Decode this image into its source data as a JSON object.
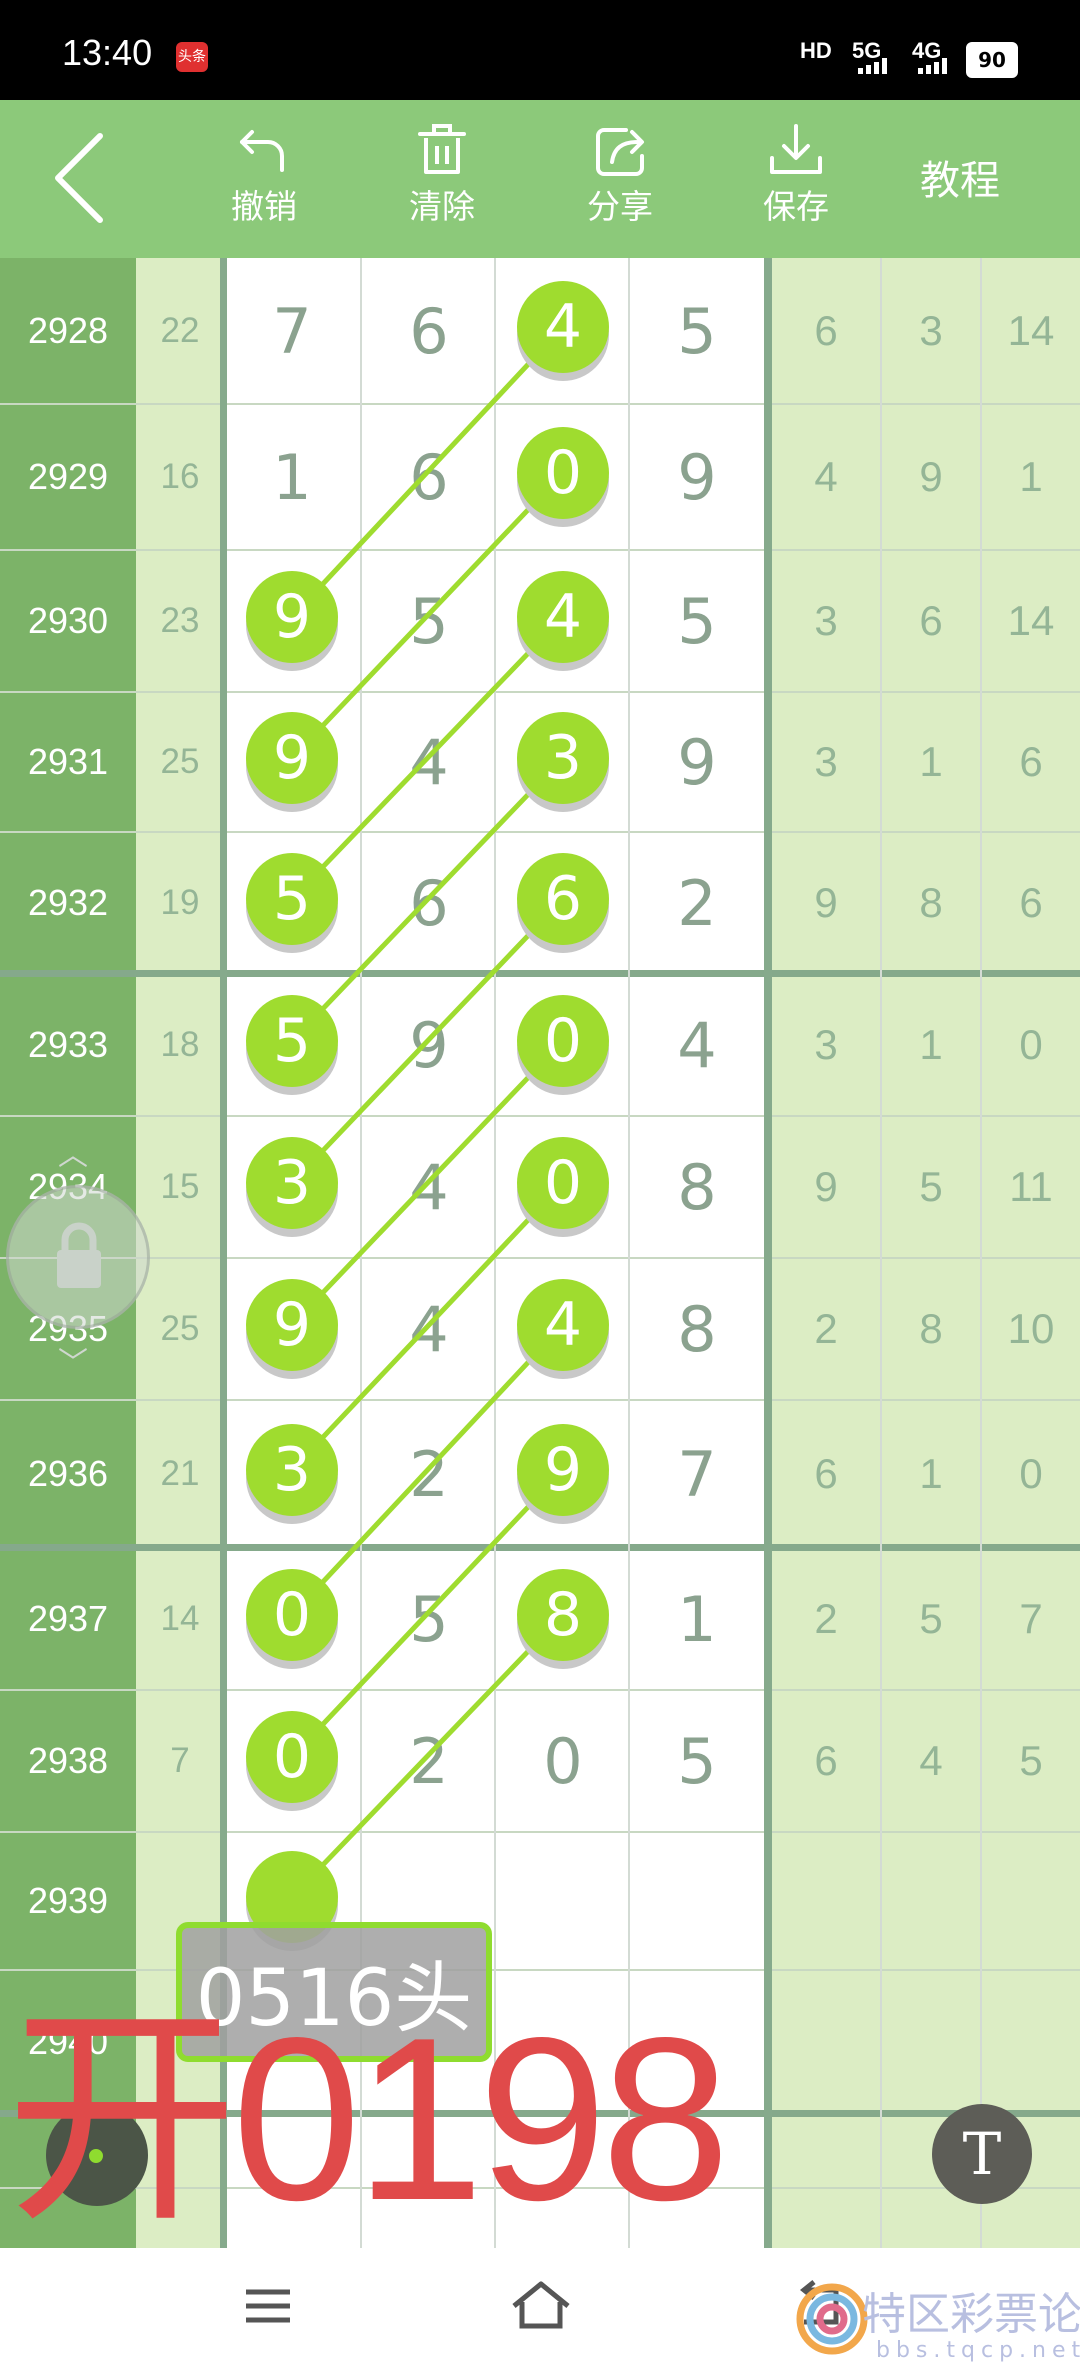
{
  "status_bar": {
    "time": "13:40",
    "app_badge": "头条",
    "hd_label": "HD",
    "net1": "5G",
    "net2": "4G",
    "battery": "90"
  },
  "toolbar": {
    "undo": "撤销",
    "clear": "清除",
    "share": "分享",
    "save": "保存",
    "tutorial": "教程"
  },
  "table": {
    "rows": [
      {
        "issue": "2928",
        "sum": "22",
        "digits": [
          "7",
          "6",
          "4",
          "5"
        ],
        "right": [
          "6",
          "3",
          "14"
        ]
      },
      {
        "issue": "2929",
        "sum": "16",
        "digits": [
          "1",
          "6",
          "0",
          "9"
        ],
        "right": [
          "4",
          "9",
          "1"
        ]
      },
      {
        "issue": "2930",
        "sum": "23",
        "digits": [
          "9",
          "5",
          "4",
          "5"
        ],
        "right": [
          "3",
          "6",
          "14"
        ]
      },
      {
        "issue": "2931",
        "sum": "25",
        "digits": [
          "9",
          "4",
          "3",
          "9"
        ],
        "right": [
          "3",
          "1",
          "6"
        ]
      },
      {
        "issue": "2932",
        "sum": "19",
        "digits": [
          "5",
          "6",
          "6",
          "2"
        ],
        "right": [
          "9",
          "8",
          "6"
        ]
      },
      {
        "issue": "2933",
        "sum": "18",
        "digits": [
          "5",
          "9",
          "0",
          "4"
        ],
        "right": [
          "3",
          "1",
          "0"
        ]
      },
      {
        "issue": "2934",
        "sum": "15",
        "digits": [
          "3",
          "4",
          "0",
          "8"
        ],
        "right": [
          "9",
          "5",
          "11"
        ]
      },
      {
        "issue": "2935",
        "sum": "25",
        "digits": [
          "9",
          "4",
          "4",
          "8"
        ],
        "right": [
          "2",
          "8",
          "10"
        ]
      },
      {
        "issue": "2936",
        "sum": "21",
        "digits": [
          "3",
          "2",
          "9",
          "7"
        ],
        "right": [
          "6",
          "1",
          "0"
        ]
      },
      {
        "issue": "2937",
        "sum": "14",
        "digits": [
          "0",
          "5",
          "8",
          "1"
        ],
        "right": [
          "2",
          "5",
          "7"
        ]
      },
      {
        "issue": "2938",
        "sum": "7",
        "digits": [
          "0",
          "2",
          "0",
          "5"
        ],
        "right": [
          "6",
          "4",
          "5"
        ]
      },
      {
        "issue": "2939",
        "sum": "",
        "digits": [
          "",
          "",
          "",
          ""
        ],
        "right": [
          "",
          "",
          ""
        ]
      },
      {
        "issue": "2940",
        "sum": "",
        "digits": [
          "",
          "",
          "",
          ""
        ],
        "right": [
          "",
          "",
          ""
        ]
      },
      {
        "issue": "",
        "sum": "",
        "digits": [
          "",
          "",
          "",
          ""
        ],
        "right": [
          "",
          "",
          ""
        ]
      },
      {
        "issue": "",
        "sum": "",
        "digits": [
          "",
          "",
          "",
          ""
        ],
        "right": [
          "",
          "",
          ""
        ]
      }
    ],
    "marks": [
      {
        "row": 0,
        "col": 2
      },
      {
        "row": 1,
        "col": 2
      },
      {
        "row": 2,
        "col": 0
      },
      {
        "row": 2,
        "col": 2
      },
      {
        "row": 3,
        "col": 0
      },
      {
        "row": 3,
        "col": 2
      },
      {
        "row": 4,
        "col": 0
      },
      {
        "row": 4,
        "col": 2
      },
      {
        "row": 5,
        "col": 0
      },
      {
        "row": 5,
        "col": 2
      },
      {
        "row": 6,
        "col": 0
      },
      {
        "row": 6,
        "col": 2
      },
      {
        "row": 7,
        "col": 0
      },
      {
        "row": 7,
        "col": 2
      },
      {
        "row": 8,
        "col": 0
      },
      {
        "row": 8,
        "col": 2
      },
      {
        "row": 9,
        "col": 0
      },
      {
        "row": 9,
        "col": 2
      },
      {
        "row": 10,
        "col": 0
      },
      {
        "row": 11,
        "col": 0
      }
    ],
    "connections": [
      [
        [
          2,
          0
        ],
        [
          0,
          2
        ]
      ],
      [
        [
          3,
          0
        ],
        [
          1,
          2
        ]
      ],
      [
        [
          4,
          0
        ],
        [
          2,
          2
        ]
      ],
      [
        [
          5,
          0
        ],
        [
          3,
          2
        ]
      ],
      [
        [
          6,
          0
        ],
        [
          4,
          2
        ]
      ],
      [
        [
          7,
          0
        ],
        [
          5,
          2
        ]
      ],
      [
        [
          8,
          0
        ],
        [
          6,
          2
        ]
      ],
      [
        [
          9,
          0
        ],
        [
          7,
          2
        ]
      ],
      [
        [
          10,
          0
        ],
        [
          8,
          2
        ]
      ],
      [
        [
          11,
          0
        ],
        [
          9,
          2
        ]
      ]
    ]
  },
  "annotation": {
    "note": "0516头",
    "result": "开0198",
    "t_button": "T"
  },
  "watermark": {
    "text": "特区彩票论坛",
    "sub": "bbs.tqcp.net"
  },
  "colors": {
    "toolbar": "#8cc97a",
    "issue_col": "#7cb368",
    "ball": "#9fdc2f",
    "result": "#e04a4a"
  }
}
